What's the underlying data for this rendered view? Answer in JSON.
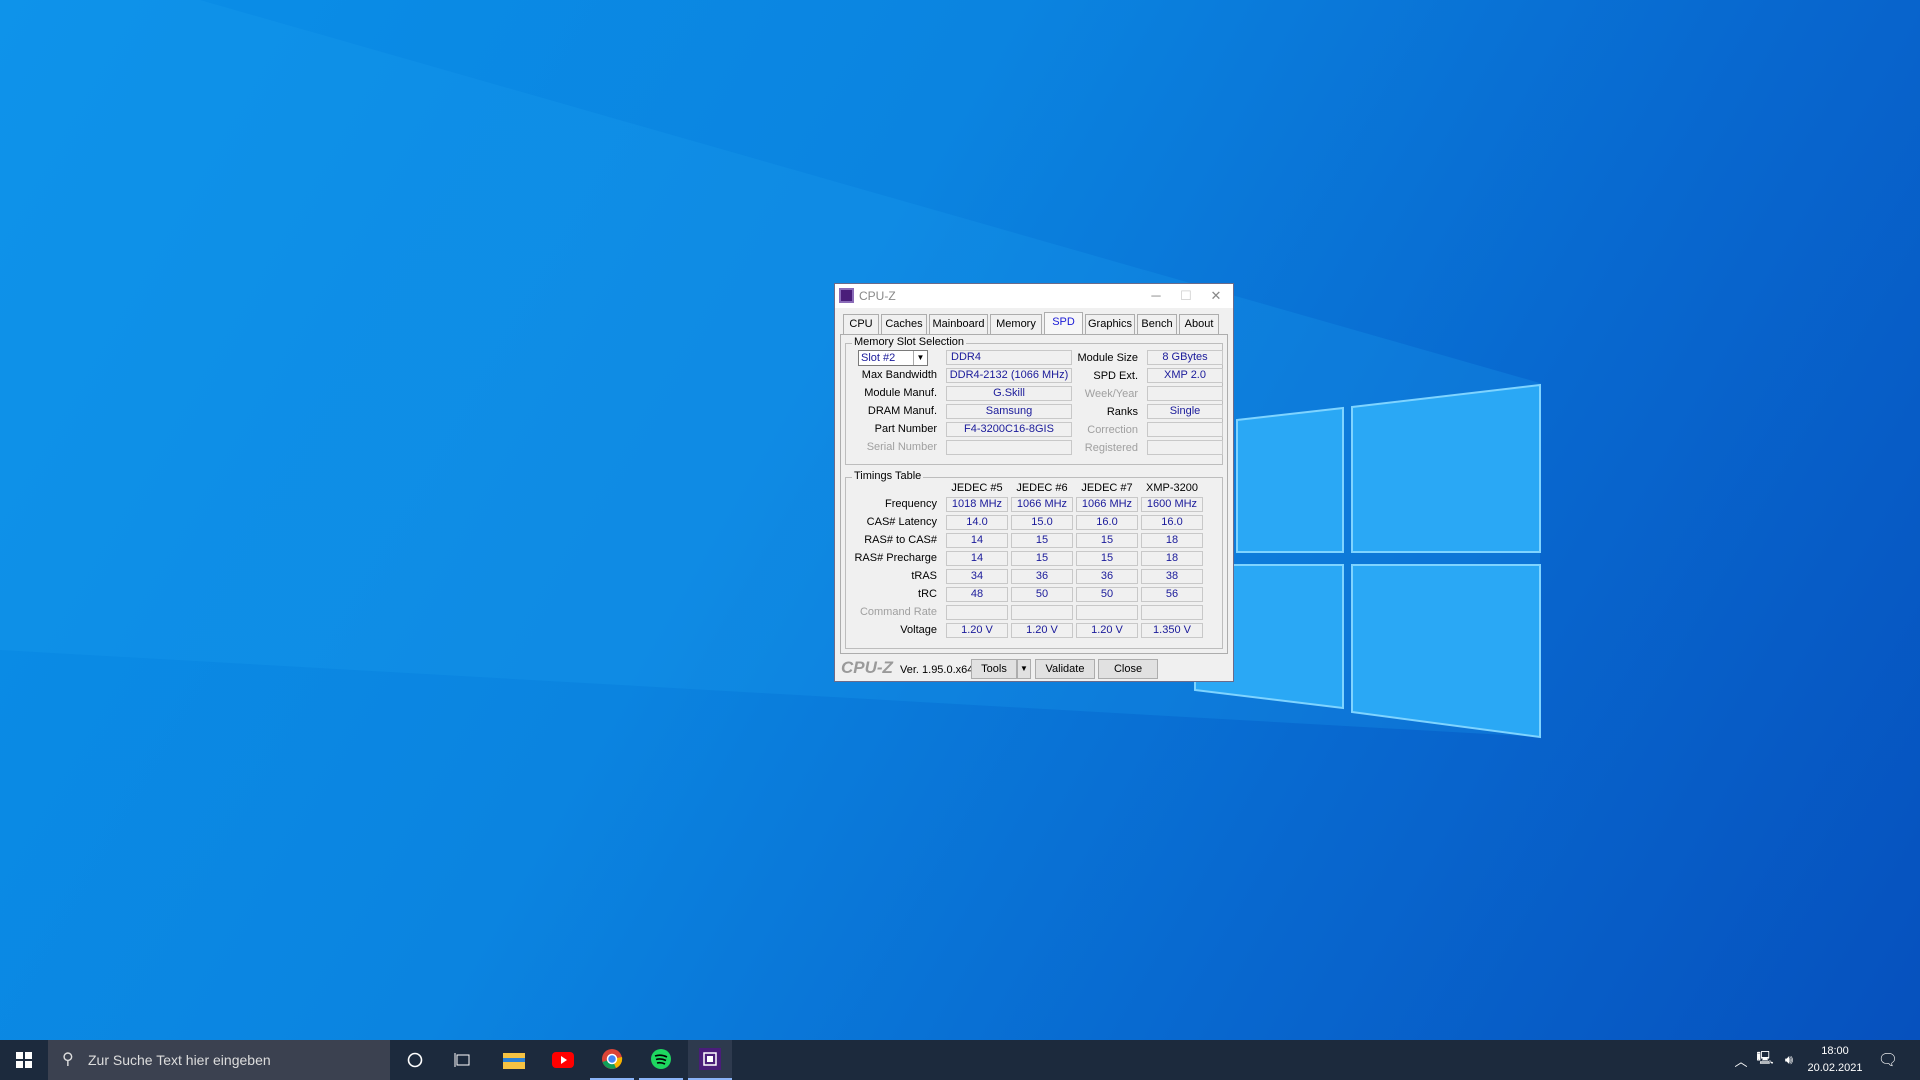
{
  "window": {
    "title": "CPU-Z",
    "minimize": "─",
    "maximize": "☐",
    "close": "✕"
  },
  "tabs": [
    "CPU",
    "Caches",
    "Mainboard",
    "Memory",
    "SPD",
    "Graphics",
    "Bench",
    "About"
  ],
  "selected_tab": "SPD",
  "slot": {
    "group_label": "Memory Slot Selection",
    "selected": "Slot #2",
    "type": "DDR4",
    "left": [
      {
        "label": "Max Bandwidth",
        "value": "DDR4-2132 (1066 MHz)"
      },
      {
        "label": "Module Manuf.",
        "value": "G.Skill"
      },
      {
        "label": "DRAM Manuf.",
        "value": "Samsung"
      },
      {
        "label": "Part Number",
        "value": "F4-3200C16-8GIS"
      },
      {
        "label": "Serial Number",
        "value": ""
      }
    ],
    "right": [
      {
        "label": "Module Size",
        "value": "8 GBytes"
      },
      {
        "label": "SPD Ext.",
        "value": "XMP 2.0"
      },
      {
        "label": "Week/Year",
        "value": ""
      },
      {
        "label": "Ranks",
        "value": "Single"
      },
      {
        "label": "Correction",
        "value": ""
      },
      {
        "label": "Registered",
        "value": ""
      }
    ]
  },
  "timings": {
    "group_label": "Timings Table",
    "columns": [
      "JEDEC #5",
      "JEDEC #6",
      "JEDEC #7",
      "XMP-3200"
    ],
    "rows": [
      {
        "label": "Frequency",
        "values": [
          "1018 MHz",
          "1066 MHz",
          "1066 MHz",
          "1600 MHz"
        ]
      },
      {
        "label": "CAS# Latency",
        "values": [
          "14.0",
          "15.0",
          "16.0",
          "16.0"
        ]
      },
      {
        "label": "RAS# to CAS#",
        "values": [
          "14",
          "15",
          "15",
          "18"
        ]
      },
      {
        "label": "RAS# Precharge",
        "values": [
          "14",
          "15",
          "15",
          "18"
        ]
      },
      {
        "label": "tRAS",
        "values": [
          "34",
          "36",
          "36",
          "38"
        ]
      },
      {
        "label": "tRC",
        "values": [
          "48",
          "50",
          "50",
          "56"
        ]
      },
      {
        "label": "Command Rate",
        "values": [
          "",
          "",
          "",
          ""
        ]
      },
      {
        "label": "Voltage",
        "values": [
          "1.20 V",
          "1.20 V",
          "1.20 V",
          "1.350 V"
        ]
      }
    ]
  },
  "footer": {
    "logo": "CPU-Z",
    "version": "Ver. 1.95.0.x64",
    "tools": "Tools",
    "validate": "Validate",
    "close": "Close"
  },
  "taskbar": {
    "search_placeholder": "Zur Suche Text hier eingeben",
    "time": "18:00",
    "date": "20.02.2021"
  }
}
